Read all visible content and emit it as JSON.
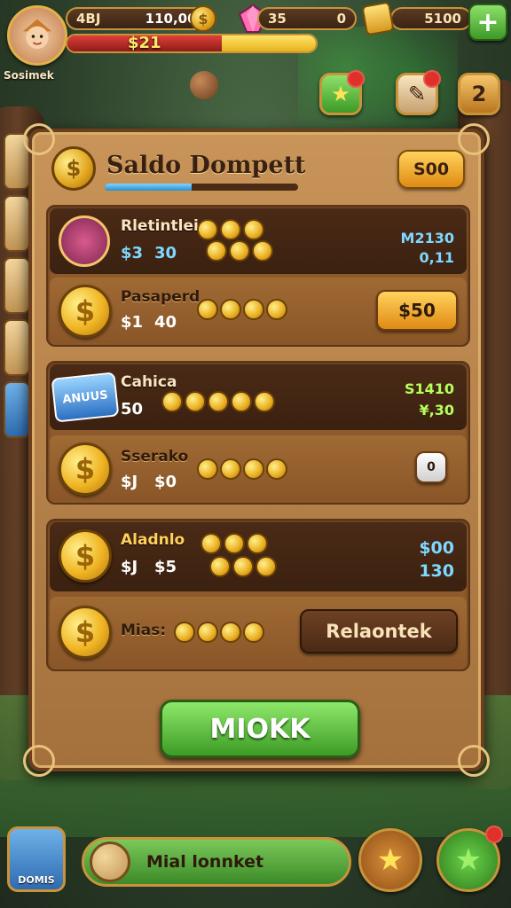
{
  "hud": {
    "player_name": "Sosimek",
    "left_value_a": "4BJ",
    "left_value_b": "110,000",
    "xp_label": "$21",
    "mid_value_a": "35",
    "mid_value_b": "0",
    "right_value": "5100",
    "plus_label": "+"
  },
  "side_buttons": {
    "star": "★",
    "scroll": "✎",
    "two": "2"
  },
  "panel": {
    "title": "Saldo Dompett",
    "balance": "S00"
  },
  "rows": [
    {
      "label": "Rletintlei",
      "sub_a": "$3",
      "sub_b": "30",
      "right_top": "M2130",
      "right_bottom": "0,11"
    },
    {
      "label": "Pasaperd",
      "sub_a": "$1",
      "sub_b": "40",
      "button": "$50"
    },
    {
      "label": "Cahica",
      "sub_a": "50",
      "right_top": "S1410",
      "right_bottom": "¥,30",
      "badge": "ANUUS"
    },
    {
      "label": "Sserako",
      "sub_a": "$J",
      "sub_b": "$0",
      "button": "0"
    },
    {
      "label": "Aladnlo",
      "sub_a": "$J",
      "sub_b": "$5",
      "right_top": "$00",
      "right_bottom": "130"
    },
    {
      "label": "Mias:",
      "button": "Relaontek"
    }
  ],
  "main_button": "MIOKK",
  "bottom": {
    "house_label": "DOMIS",
    "pill_label": "Mial lonnket",
    "star_left": "★",
    "star_right": "★"
  }
}
